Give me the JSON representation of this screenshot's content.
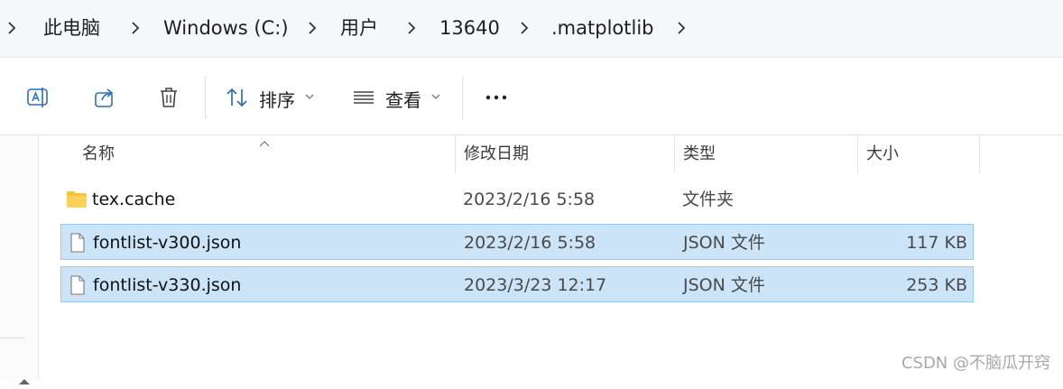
{
  "breadcrumb": {
    "items": [
      "此电脑",
      "Windows (C:)",
      "用户",
      "13640",
      ".matplotlib"
    ]
  },
  "toolbar": {
    "sort_label": "排序",
    "view_label": "查看",
    "more_label": "···"
  },
  "columns": {
    "name": "名称",
    "modified": "修改日期",
    "type": "类型",
    "size": "大小"
  },
  "files": [
    {
      "name": "tex.cache",
      "modified": "2023/2/16 5:58",
      "type": "文件夹",
      "size": "",
      "kind": "folder-icon",
      "selected": false
    },
    {
      "name": "fontlist-v300.json",
      "modified": "2023/2/16 5:58",
      "type": "JSON 文件",
      "size": "117 KB",
      "kind": "file-icon",
      "selected": true
    },
    {
      "name": "fontlist-v330.json",
      "modified": "2023/3/23 12:17",
      "type": "JSON 文件",
      "size": "253 KB",
      "kind": "file-icon",
      "selected": true
    }
  ],
  "watermark": "CSDN @不脑瓜开窍",
  "colors": {
    "selection_bg": "#cce4f7",
    "selection_border": "#99c9ef",
    "folder": "#f8c23a"
  }
}
